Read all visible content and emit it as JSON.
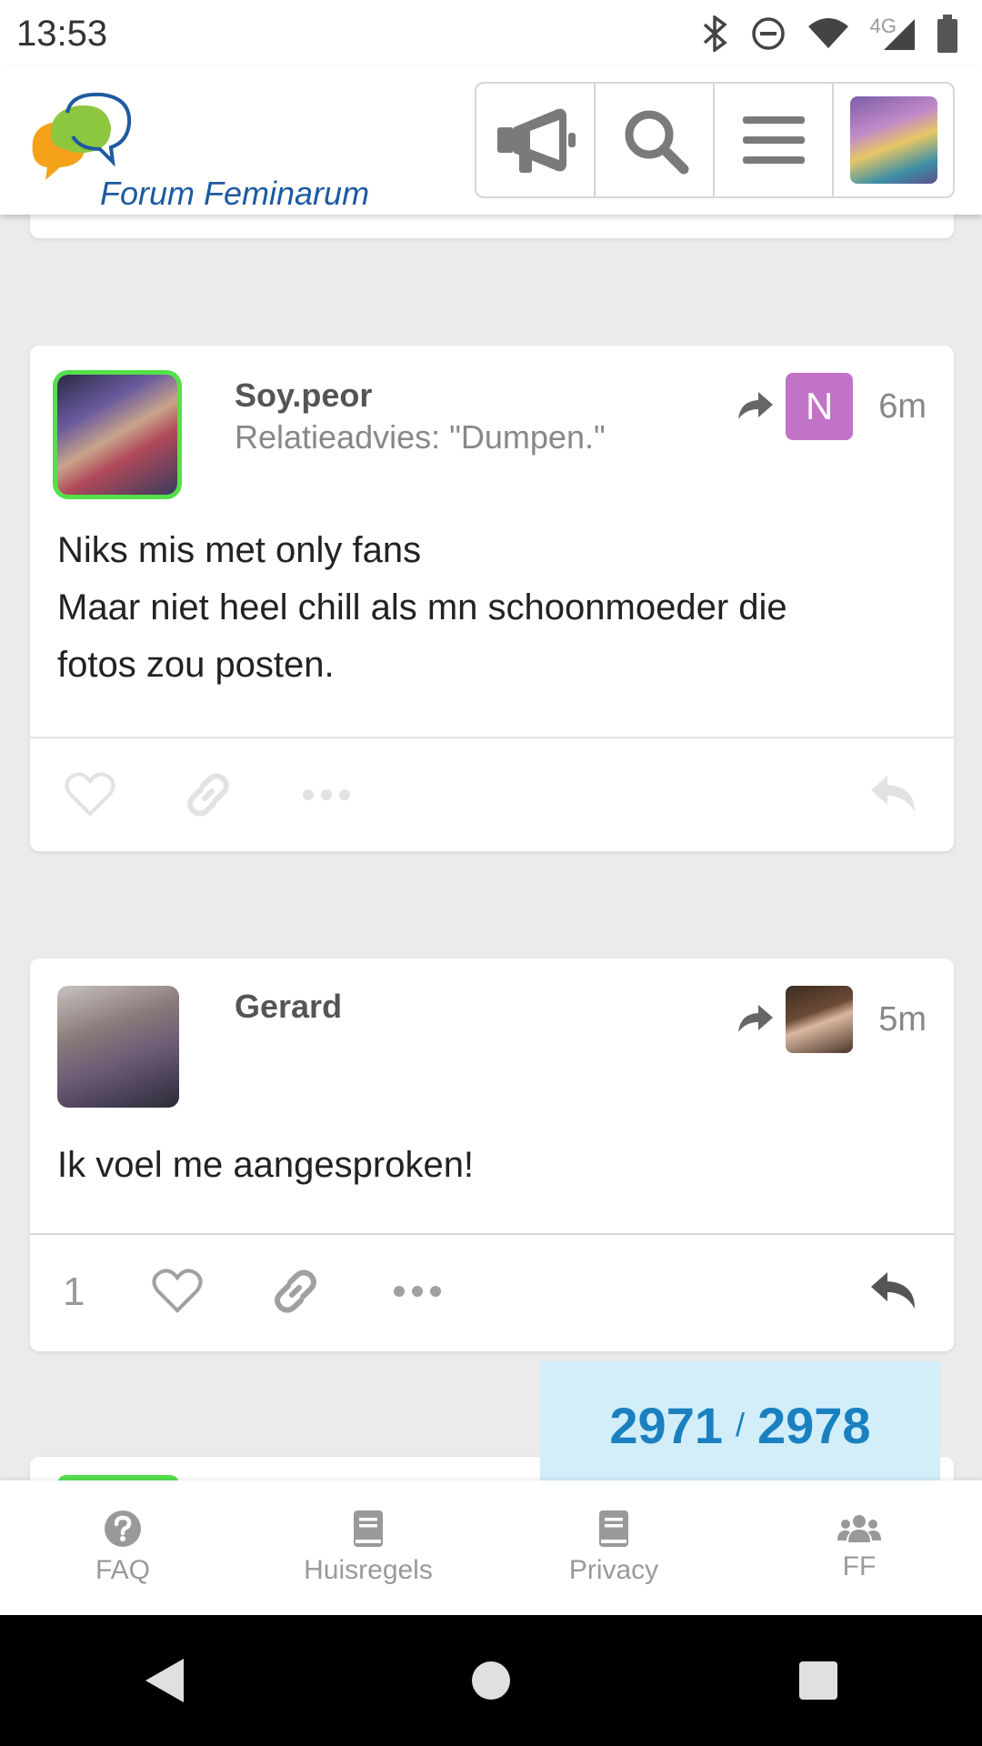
{
  "status_bar": {
    "time": "13:53",
    "network_label": "4G",
    "icons": [
      "bluetooth-icon",
      "do-not-disturb-icon",
      "wifi-icon",
      "cell-signal-icon",
      "battery-icon"
    ]
  },
  "header": {
    "logo_text": "Forum Feminarum",
    "buttons": [
      "megaphone-icon",
      "search-icon",
      "menu-icon",
      "user-avatar"
    ]
  },
  "posts": [
    {
      "username": "Soy.peor",
      "subtitle": "Relatieadvies: \"Dumpen.\"",
      "reply_to_badge": "N",
      "time_ago": "6m",
      "body_lines": [
        "Niks mis met only fans",
        "Maar niet heel chill als mn schoonmoeder die",
        "fotos zou posten."
      ],
      "online": true
    },
    {
      "username": "Gerard",
      "time_ago": "5m",
      "body_lines": [
        "Ik voel me aangesproken!"
      ],
      "like_count": "1"
    }
  ],
  "progress": {
    "current": "2971",
    "separator": "/",
    "total": "2978"
  },
  "footer_nav": [
    {
      "label": "FAQ",
      "icon": "question-circle-icon"
    },
    {
      "label": "Huisregels",
      "icon": "book-icon"
    },
    {
      "label": "Privacy",
      "icon": "book-icon"
    },
    {
      "label": "FF",
      "icon": "users-icon"
    }
  ],
  "colors": {
    "accent_blue": "#1a80c0",
    "progress_bg": "#d1eef9",
    "online_green": "#53e04a",
    "badge_purple": "#c173c8",
    "logo_blue": "#1d5aa0"
  }
}
